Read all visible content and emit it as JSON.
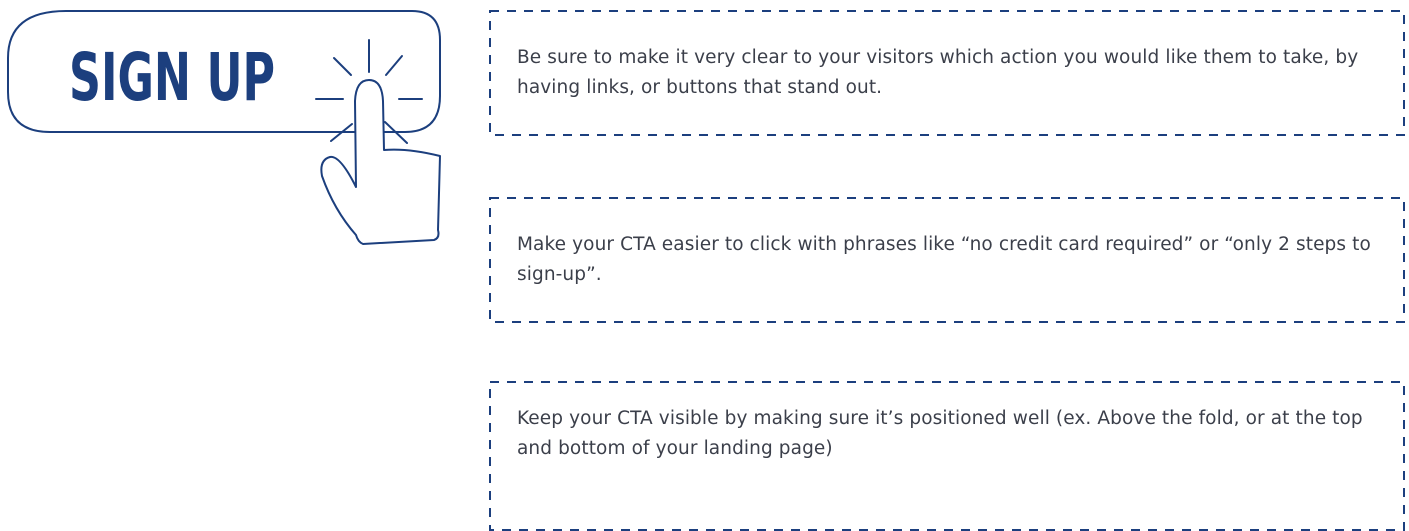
{
  "button": {
    "label": "SIGN UP"
  },
  "tips": [
    {
      "text": "Be sure to make it very clear to your visitors which action you would like them to take, by having links, or buttons that stand out."
    },
    {
      "text": "Make your CTA easier to click with phrases like “no credit card required” or “only 2 steps to sign-up”."
    },
    {
      "text": "Keep your CTA visible by making sure it’s positioned well (ex. Above the fold, or at the top and bottom of your landing page)"
    }
  ],
  "colors": {
    "navy": "#1c3f7e",
    "text": "#3b3f4a",
    "border": "#1c3f7e"
  },
  "icons": [
    "pointer-hand-icon",
    "click-burst-icon"
  ]
}
